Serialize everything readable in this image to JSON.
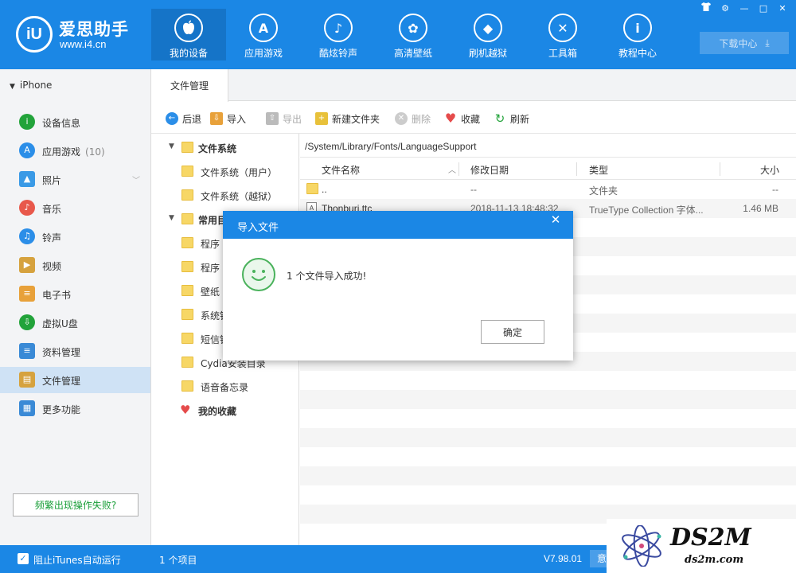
{
  "app": {
    "logo_mark": "iU",
    "name": "爱思助手",
    "url": "www.i4.cn"
  },
  "nav": [
    {
      "label": "我的设备",
      "icon": "apple-icon",
      "glyph": "",
      "active": true
    },
    {
      "label": "应用游戏",
      "icon": "app-store-icon",
      "glyph": "A"
    },
    {
      "label": "酷炫铃声",
      "icon": "bell-icon",
      "glyph": "♪"
    },
    {
      "label": "高清壁纸",
      "icon": "flower-icon",
      "glyph": "✿"
    },
    {
      "label": "刷机越狱",
      "icon": "dropbox-icon",
      "glyph": "◆"
    },
    {
      "label": "工具箱",
      "icon": "tools-icon",
      "glyph": "✕"
    },
    {
      "label": "教程中心",
      "icon": "info-icon",
      "glyph": "i"
    }
  ],
  "window_controls": [
    "shirt-icon",
    "gear-icon",
    "minimize-icon",
    "maximize-icon",
    "close-icon"
  ],
  "download_center": "下载中心",
  "sidebar": {
    "device": "iPhone",
    "items": [
      {
        "label": "设备信息",
        "icon": "info-circle-icon",
        "color": "#22a33a"
      },
      {
        "label": "应用游戏",
        "icon": "app-store-icon",
        "color": "#2b8ee8",
        "count": "(10)"
      },
      {
        "label": "照片",
        "icon": "photo-icon",
        "color": "#3a9ae6"
      },
      {
        "label": "音乐",
        "icon": "music-icon",
        "color": "#e8584b"
      },
      {
        "label": "铃声",
        "icon": "bell-icon",
        "color": "#2b8ee8"
      },
      {
        "label": "视频",
        "icon": "video-icon",
        "color": "#d6a23e"
      },
      {
        "label": "电子书",
        "icon": "book-icon",
        "color": "#e8a13a"
      },
      {
        "label": "虚拟U盘",
        "icon": "usb-icon",
        "color": "#22a33a"
      },
      {
        "label": "资料管理",
        "icon": "list-icon",
        "color": "#3a8ad6"
      },
      {
        "label": "文件管理",
        "icon": "file-icon",
        "color": "#d6a23e",
        "active": true
      },
      {
        "label": "更多功能",
        "icon": "grid-icon",
        "color": "#3a8ad6"
      }
    ],
    "help_button": "频繁出现操作失败?"
  },
  "tab": "文件管理",
  "toolbar": [
    {
      "label": "后退",
      "icon": "back-icon",
      "color": "#2b8ee8",
      "disabled": false
    },
    {
      "label": "导入",
      "icon": "import-icon",
      "color": "#e8a13a",
      "disabled": false
    },
    {
      "label": "导出",
      "icon": "export-icon",
      "color": "#bbbbbb",
      "disabled": true
    },
    {
      "label": "新建文件夹",
      "icon": "new-folder-icon",
      "color": "#e8c13a",
      "disabled": false
    },
    {
      "label": "删除",
      "icon": "delete-icon",
      "color": "#cccccc",
      "disabled": true
    },
    {
      "label": "收藏",
      "icon": "heart-icon",
      "color": "#e54b4b",
      "disabled": false
    },
    {
      "label": "刷新",
      "icon": "refresh-icon",
      "color": "#22a33a",
      "disabled": false
    }
  ],
  "tree": [
    {
      "label": "文件系统",
      "level": 0,
      "bold": true,
      "expanded": true
    },
    {
      "label": "文件系统（用户）",
      "level": 1
    },
    {
      "label": "文件系统（越狱）",
      "level": 1
    },
    {
      "label": "常用目录",
      "level": 0,
      "bold": true,
      "expanded": true
    },
    {
      "label": "程序",
      "level": 1
    },
    {
      "label": "程序",
      "level": 1
    },
    {
      "label": "壁纸",
      "level": 1
    },
    {
      "label": "系统铃声",
      "level": 1
    },
    {
      "label": "短信铃声",
      "level": 1
    },
    {
      "label": "Cydia安装目录",
      "level": 1
    },
    {
      "label": "语音备忘录",
      "level": 1
    },
    {
      "label": "我的收藏",
      "level": 0,
      "bold": true,
      "favorite": true
    }
  ],
  "path": "/System/Library/Fonts/LanguageSupport",
  "columns": {
    "name": "文件名称",
    "date": "修改日期",
    "type": "类型",
    "size": "大小"
  },
  "files": [
    {
      "name": "..",
      "date": "--",
      "type": "文件夹",
      "size": "--",
      "folder": true
    },
    {
      "name": "Thonburi.ttc",
      "date": "2018-11-13 18:48:32",
      "type": "TrueType Collection 字体...",
      "size": "1.46 MB",
      "folder": false
    }
  ],
  "dialog": {
    "title": "导入文件",
    "close": "✕",
    "message": "1 个文件导入成功!",
    "ok": "确定"
  },
  "status": {
    "checkbox_label": "阻止iTunes自动运行",
    "item_count": "1 个项目",
    "version": "V7.98.01",
    "button": "意"
  },
  "watermark": {
    "big": "DS2M",
    "small": "ds2m.com"
  }
}
